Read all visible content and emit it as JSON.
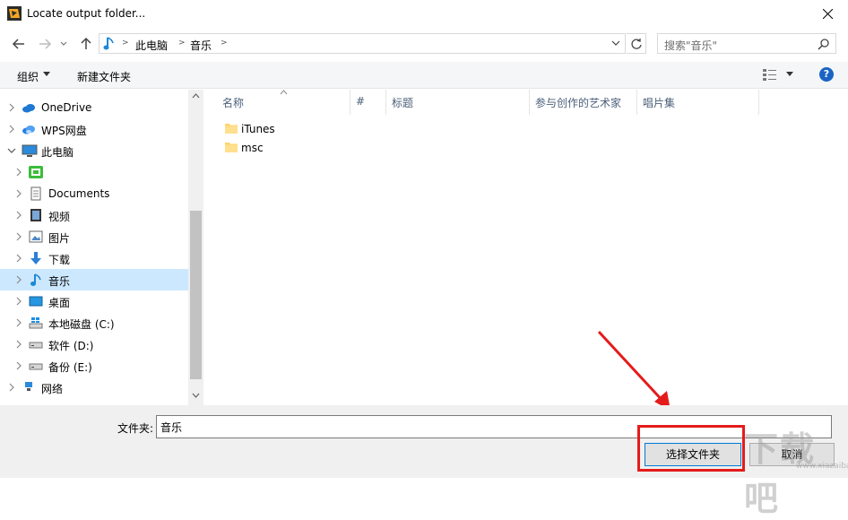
{
  "window": {
    "title": "Locate output folder..."
  },
  "address": {
    "crumbs": [
      "此电脑",
      "音乐"
    ]
  },
  "search": {
    "placeholder": "搜索\"音乐\""
  },
  "toolbar": {
    "organize_label": "组织",
    "new_folder_label": "新建文件夹"
  },
  "help_glyph": "?",
  "nav_tree": [
    {
      "label": "OneDrive",
      "icon": "cloud-icon"
    },
    {
      "label": "WPS网盘",
      "icon": "wps-cloud-icon"
    },
    {
      "label": "此电脑",
      "icon": "computer-icon"
    },
    {
      "label": "",
      "icon": "green-app-icon"
    },
    {
      "label": "Documents",
      "icon": "documents-icon"
    },
    {
      "label": "视频",
      "icon": "video-icon"
    },
    {
      "label": "图片",
      "icon": "pictures-icon"
    },
    {
      "label": "下载",
      "icon": "download-icon"
    },
    {
      "label": "音乐",
      "icon": "music-icon",
      "selected": true
    },
    {
      "label": "桌面",
      "icon": "desktop-icon"
    },
    {
      "label": "本地磁盘 (C:)",
      "icon": "drive-c-icon"
    },
    {
      "label": "软件 (D:)",
      "icon": "drive-icon"
    },
    {
      "label": "备份 (E:)",
      "icon": "drive-icon"
    },
    {
      "label": "网络",
      "icon": "network-icon"
    }
  ],
  "columns": [
    "名称",
    "#",
    "标题",
    "参与创作的艺术家",
    "唱片集"
  ],
  "files": [
    {
      "name": "iTunes"
    },
    {
      "name": "msc"
    }
  ],
  "bottom": {
    "folder_label": "文件夹:",
    "folder_value": "音乐",
    "select_label": "选择文件夹",
    "cancel_label": "取消"
  },
  "watermark": {
    "text": "下载吧",
    "url": "www.xiazaiba.com"
  },
  "colors": {
    "selection": "#cce8ff",
    "accent": "#0078d7",
    "annotation": "#e51b1b",
    "help": "#1a63c5"
  }
}
